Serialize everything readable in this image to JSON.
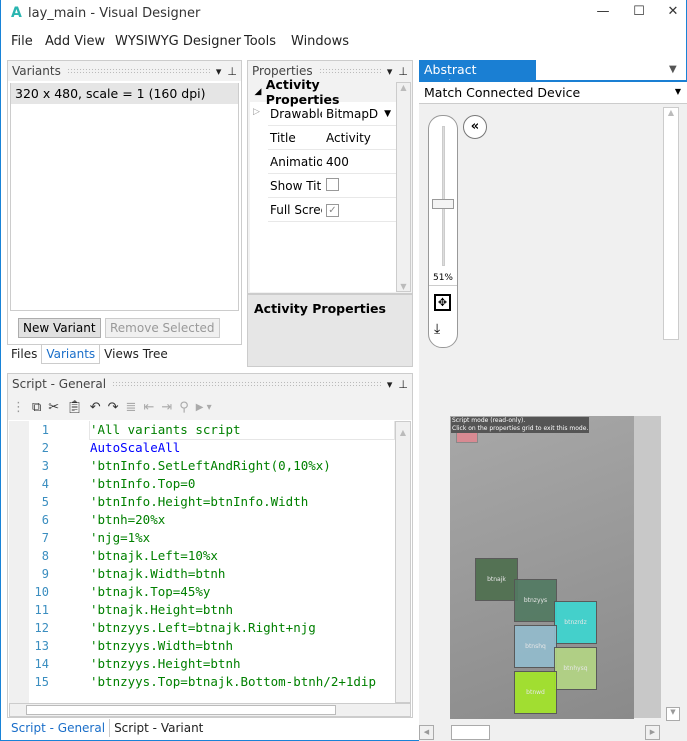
{
  "window": {
    "title": "lay_main - Visual Designer",
    "logo": "A",
    "minimize": "—",
    "maximize": "☐",
    "close": "✕"
  },
  "menu": [
    "File",
    "Add View",
    "WYSIWYG Designer",
    "Tools",
    "Windows"
  ],
  "variants": {
    "title": "Variants",
    "items": [
      "320 x 480, scale = 1 (160 dpi)"
    ],
    "new_button": "New Variant",
    "remove_button": "Remove Selected"
  },
  "left_tabs": [
    "Files",
    "Variants",
    "Views Tree"
  ],
  "properties": {
    "title": "Properties",
    "group": "Activity Properties",
    "rows": [
      {
        "name": "Drawable",
        "value": "BitmapD"
      },
      {
        "name": "Title",
        "value": "Activity"
      },
      {
        "name": "Animation",
        "value": "400"
      },
      {
        "name": "Show Title",
        "checked": false
      },
      {
        "name": "Full Screen",
        "checked": true
      }
    ],
    "description_title": "Activity Properties"
  },
  "script": {
    "title": "Script - General",
    "lines": [
      "'All variants script",
      "AutoScaleAll",
      "'btnInfo.SetLeftAndRight(0,10%x)",
      "'btnInfo.Top=0",
      "'btnInfo.Height=btnInfo.Width",
      "'btnh=20%x",
      "'njg=1%x",
      "'btnajk.Left=10%x",
      "'btnajk.Width=btnh",
      "'btnajk.Top=45%y",
      "'btnajk.Height=btnh",
      "'btnzyys.Left=btnajk.Right+njg",
      "'btnzyys.Width=btnh",
      "'btnzyys.Height=btnh",
      "'btnzyys.Top=btnajk.Bottom-btnh/2+1dip"
    ],
    "tabs": [
      "Script - General",
      "Script - Variant"
    ],
    "comment_color": "#008000",
    "keyword_color": "#0000ff"
  },
  "designer": {
    "title": "Abstract Designer",
    "device": "Match Connected Device",
    "zoom": "51%",
    "zoom_level_percent": 51,
    "notice_line1": "Script mode (read-only).",
    "notice_line2": "Click on the properties grid to exit this mode.",
    "views": [
      {
        "label": "btnajk",
        "color": "#4f6f4f"
      },
      {
        "label": "btnzyys",
        "color": "#527a62"
      },
      {
        "label": "btnzrdz",
        "color": "#3ed6d0"
      },
      {
        "label": "btnshq",
        "color": "#93bccd"
      },
      {
        "label": "btnhysq",
        "color": "#b3d585"
      },
      {
        "label": "btnwd",
        "color": "#a3e52a"
      }
    ]
  }
}
